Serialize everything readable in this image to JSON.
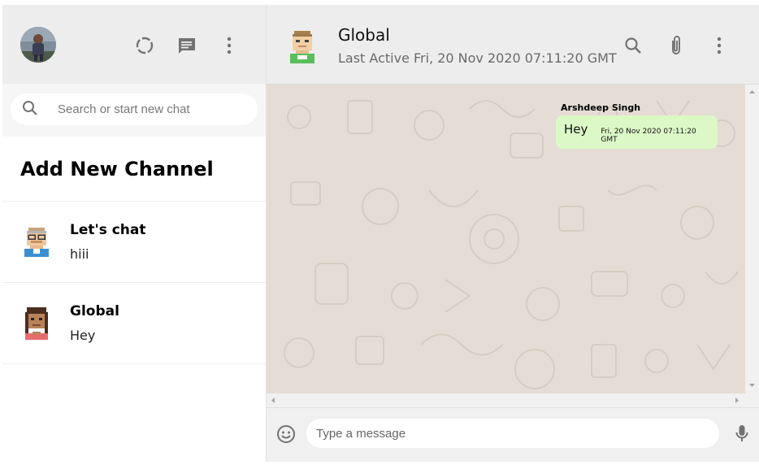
{
  "sidebar": {
    "search_placeholder": "Search or start new chat",
    "add_channel_label": "Add New Channel",
    "chats": [
      {
        "name": "Let's chat",
        "last_message": "hiii"
      },
      {
        "name": "Global",
        "last_message": "Hey"
      }
    ]
  },
  "header": {
    "room_name": "Global",
    "last_active": "Last Active Fri, 20 Nov 2020 07:11:20 GMT"
  },
  "messages": [
    {
      "sender": "Arshdeep Singh",
      "text": "Hey",
      "time": "Fri, 20 Nov 2020 07:11:20 GMT"
    }
  ],
  "footer": {
    "input_placeholder": "Type a message"
  },
  "icons": {
    "status": "status-circle-icon",
    "new_chat": "chat-bubble-icon",
    "menu": "more-vert-icon",
    "search": "search-icon",
    "attach": "paperclip-icon",
    "emoji": "smiley-icon",
    "mic": "microphone-icon"
  },
  "colors": {
    "header_bg": "#ededed",
    "chat_bg": "#e5ddd5",
    "outgoing_bubble": "#dcf8c6",
    "icon": "#919191"
  }
}
